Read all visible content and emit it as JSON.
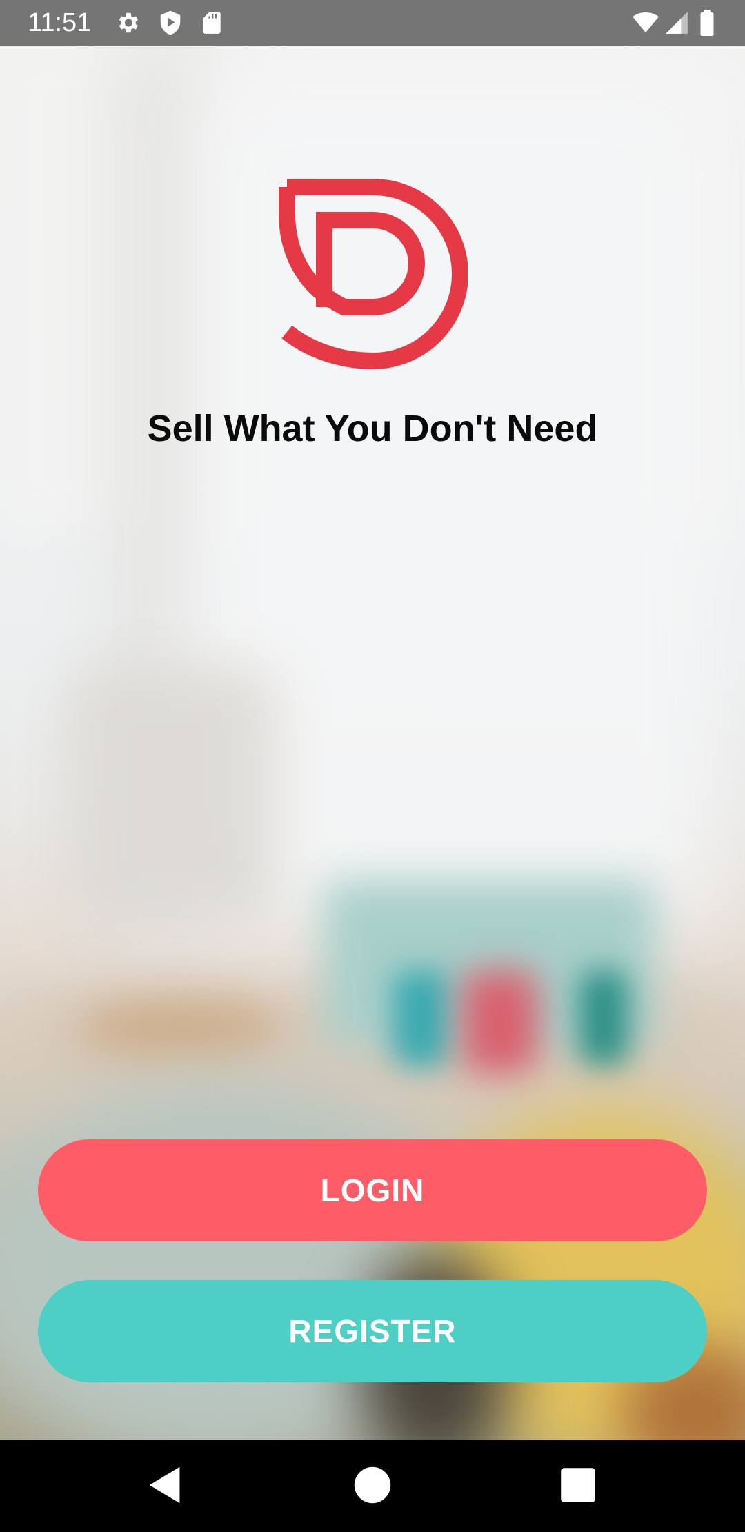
{
  "status_bar": {
    "time": "11:51",
    "left_icons": [
      "settings-icon",
      "shield-play-icon",
      "sd-card-icon"
    ],
    "right_icons": [
      "wifi-icon",
      "cellular-signal-icon",
      "battery-icon"
    ]
  },
  "welcome": {
    "logo": "brand-d-logo",
    "tagline": "Sell What You Don't Need"
  },
  "actions": {
    "login_label": "LOGIN",
    "register_label": "REGISTER"
  },
  "nav_bar": {
    "buttons": [
      "back-icon",
      "home-icon",
      "recents-icon"
    ]
  },
  "colors": {
    "brand_red": "#e63946",
    "login_button": "#fe5d67",
    "register_button": "#4ecfc6",
    "status_bar": "#757575"
  }
}
